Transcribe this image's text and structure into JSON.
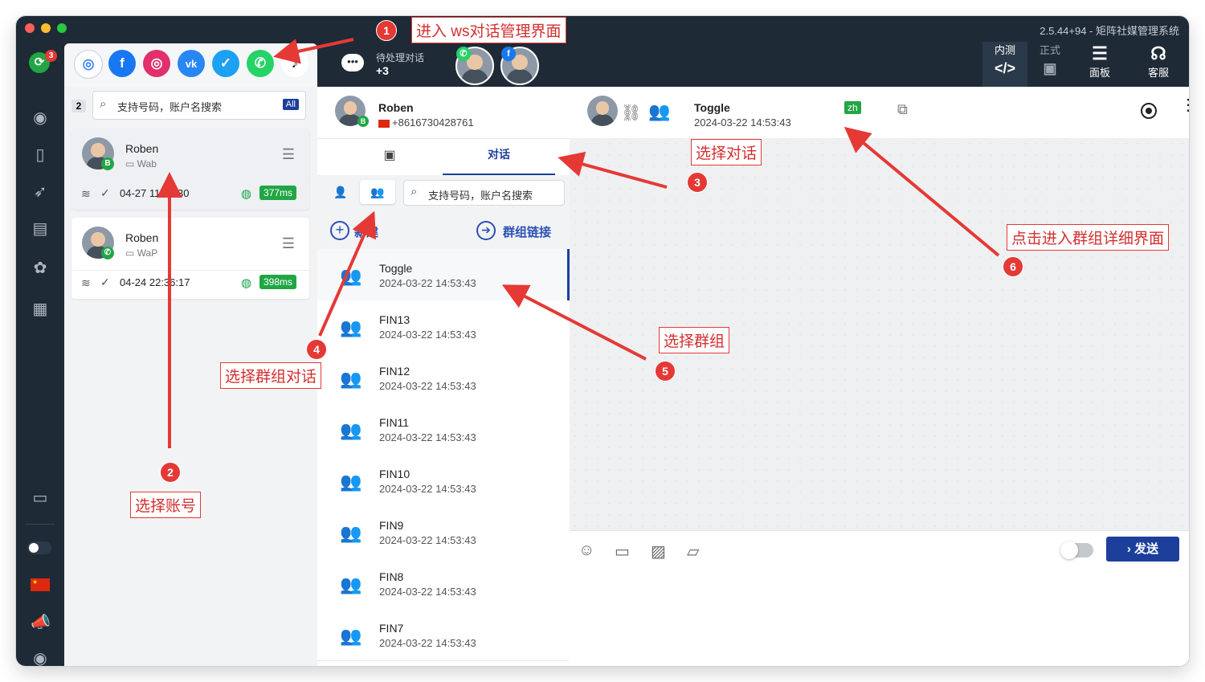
{
  "window": {
    "version_title": "2.5.44+94 - 矩阵社媒管理系统",
    "app_badge": "3"
  },
  "platforms": [
    {
      "name": "generic-icon",
      "color": "#3b82f6",
      "glyph": "◎"
    },
    {
      "name": "facebook-icon",
      "color": "#1877f2",
      "glyph": "f"
    },
    {
      "name": "instagram-icon",
      "color": "#e1306c",
      "glyph": "◎"
    },
    {
      "name": "vk-icon",
      "color": "#2787f5",
      "glyph": "vk"
    },
    {
      "name": "twitter-icon",
      "color": "#1da1f2",
      "glyph": "✓"
    },
    {
      "name": "whatsapp-icon",
      "color": "#25d366",
      "glyph": "✆"
    },
    {
      "name": "tiktok-icon",
      "color": "#111111",
      "glyph": "♪"
    }
  ],
  "pending": {
    "label": "待处理对话",
    "count": "+3"
  },
  "top_buttons": [
    {
      "label": "内测",
      "sym": "</>"
    },
    {
      "label": "正式",
      "sym": "▣"
    },
    {
      "label": "面板",
      "sym": "☰"
    },
    {
      "label": "客服",
      "sym": "☊"
    }
  ],
  "accounts": {
    "count": "2",
    "search_placeholder": "支持号码，账户名搜索",
    "all_label": "All",
    "items": [
      {
        "name": "Roben",
        "sub": "Wab",
        "time": "04-27 11:15:30",
        "latency": "377ms",
        "badge": "B"
      },
      {
        "name": "Roben",
        "sub": "WaP",
        "time": "04-24 22:36:17",
        "latency": "398ms",
        "badge": "✆"
      }
    ]
  },
  "conversation": {
    "header_name": "Roben",
    "header_phone": "+8616730428761",
    "tab_label": "对话",
    "search_placeholder": "支持号码，账户名搜索",
    "new_label": "新建",
    "group_link_label": "群组链接",
    "groups": [
      {
        "name": "Toggle",
        "date": "2024-03-22 14:53:43"
      },
      {
        "name": "FIN13",
        "date": "2024-03-22 14:53:43"
      },
      {
        "name": "FIN12",
        "date": "2024-03-22 14:53:43"
      },
      {
        "name": "FIN11",
        "date": "2024-03-22 14:53:43"
      },
      {
        "name": "FIN10",
        "date": "2024-03-22 14:53:43"
      },
      {
        "name": "FIN9",
        "date": "2024-03-22 14:53:43"
      },
      {
        "name": "FIN8",
        "date": "2024-03-22 14:53:43"
      },
      {
        "name": "FIN7",
        "date": "2024-03-22 14:53:43"
      }
    ]
  },
  "chat": {
    "title": "Toggle",
    "date": "2024-03-22 14:53:43",
    "lang": "zh",
    "send_label": "发送"
  },
  "annotations": [
    {
      "n": "1",
      "text": "进入 ws对话管理界面"
    },
    {
      "n": "2",
      "text": "选择账号"
    },
    {
      "n": "3",
      "text": "选择对话"
    },
    {
      "n": "4",
      "text": "选择群组对话"
    },
    {
      "n": "5",
      "text": "选择群组"
    },
    {
      "n": "6",
      "text": "点击进入群组详细界面"
    }
  ],
  "colors": {
    "accent": "#1d3f9c",
    "dark": "#1e2a36",
    "annotation": "#e53935",
    "ok": "#22a645"
  }
}
